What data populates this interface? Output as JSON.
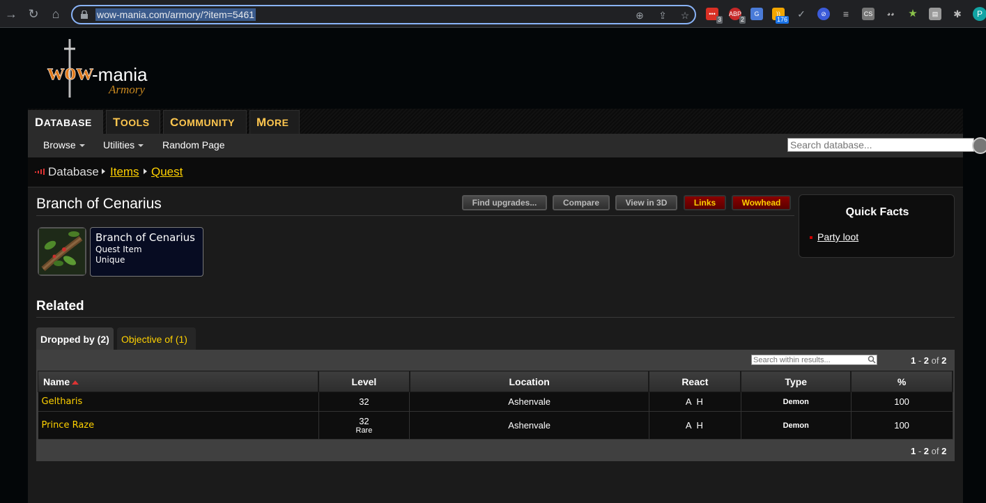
{
  "browser": {
    "url": "wow-mania.com/armory/?item=5461",
    "ext_badges": [
      "3",
      "2",
      "176"
    ],
    "profile_initial": "P"
  },
  "nav": {
    "tabs": [
      {
        "first": "D",
        "rest": "ATABASE"
      },
      {
        "first": "T",
        "rest": "OOLS"
      },
      {
        "first": "C",
        "rest": "OMMUNITY"
      },
      {
        "first": "M",
        "rest": "ORE"
      }
    ],
    "sub": [
      "Browse",
      "Utilities",
      "Random Page"
    ],
    "search_placeholder": "Search database..."
  },
  "breadcrumb": [
    "Database",
    "Items",
    "Quest"
  ],
  "item": {
    "title": "Branch of Cenarius",
    "tooltip_name": "Branch of Cenarius",
    "tooltip_type": "Quest Item",
    "tooltip_unique": "Unique"
  },
  "actions": [
    "Find upgrades...",
    "Compare",
    "View in 3D",
    "Links",
    "Wowhead"
  ],
  "quick_facts": {
    "title": "Quick Facts",
    "item": "Party loot"
  },
  "related": {
    "heading": "Related",
    "tabs": [
      "Dropped by (2)",
      "Objective of (1)"
    ],
    "search_placeholder": "Search within results...",
    "count_a": "1",
    "count_b": "2",
    "count_total": "2",
    "columns": [
      "Name",
      "Level",
      "Location",
      "React",
      "Type",
      "%"
    ],
    "rows": [
      {
        "name": "Geltharis",
        "level": "32",
        "level_sub": "",
        "location": "Ashenvale",
        "react": "A H",
        "type": "Demon",
        "pct": "100"
      },
      {
        "name": "Prince Raze",
        "level": "32",
        "level_sub": "Rare",
        "location": "Ashenvale",
        "react": "A H",
        "type": "Demon",
        "pct": "100"
      }
    ]
  }
}
